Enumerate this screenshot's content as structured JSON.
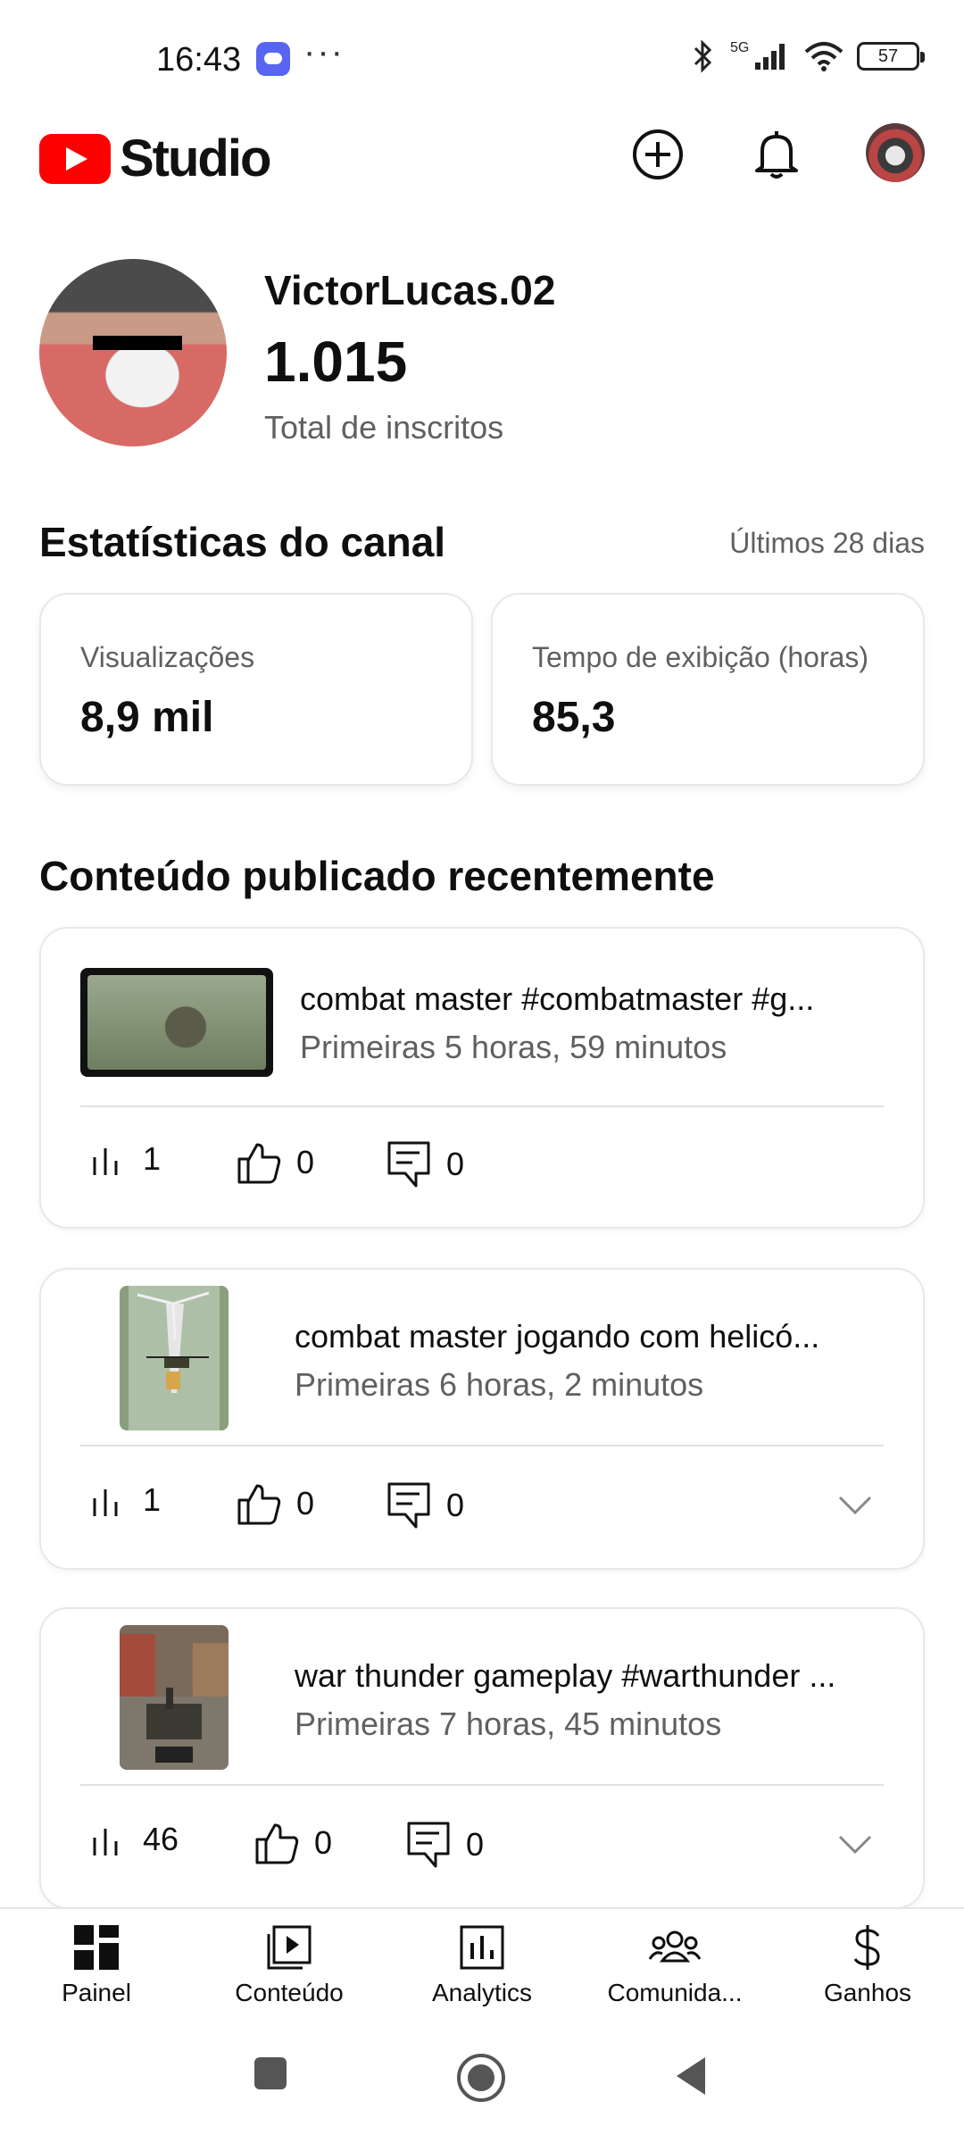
{
  "status_bar": {
    "time": "16:43",
    "dots": "···",
    "network": "5G",
    "battery": "57"
  },
  "header": {
    "logo_text": "Studio",
    "icons": [
      "create-icon",
      "bell-icon",
      "account-avatar"
    ]
  },
  "channel": {
    "name": "VictorLucas.02",
    "subscribers": "1.015",
    "subscribers_label": "Total de inscritos"
  },
  "stats": {
    "title": "Estatísticas do canal",
    "period": "Últimos 28 dias",
    "cards": [
      {
        "label": "Visualizações",
        "value": "8,9 mil"
      },
      {
        "label": "Tempo de exibição (horas)",
        "value": "85,3"
      }
    ]
  },
  "recent": {
    "title": "Conteúdo publicado recentemente",
    "videos": [
      {
        "title": "combat master #combatmaster #g...",
        "subtitle": "Primeiras 5 horas, 59 minutos",
        "views": "1",
        "likes": "0",
        "comments": "0"
      },
      {
        "title": "combat master jogando com helicó...",
        "subtitle": "Primeiras 6 horas, 2 minutos",
        "views": "1",
        "likes": "0",
        "comments": "0"
      },
      {
        "title": "war thunder gameplay #warthunder ...",
        "subtitle": "Primeiras 7 horas, 45 minutos",
        "views": "46",
        "likes": "0",
        "comments": "0"
      }
    ]
  },
  "bottom_nav": {
    "items": [
      {
        "label": "Painel",
        "icon": "dashboard-icon"
      },
      {
        "label": "Conteúdo",
        "icon": "content-icon"
      },
      {
        "label": "Analytics",
        "icon": "analytics-icon"
      },
      {
        "label": "Comunida...",
        "icon": "community-icon"
      },
      {
        "label": "Ganhos",
        "icon": "earn-icon"
      }
    ]
  },
  "colors": {
    "brand_red": "#ff0000",
    "text_primary": "#0f0f0f",
    "text_secondary": "#606060"
  }
}
